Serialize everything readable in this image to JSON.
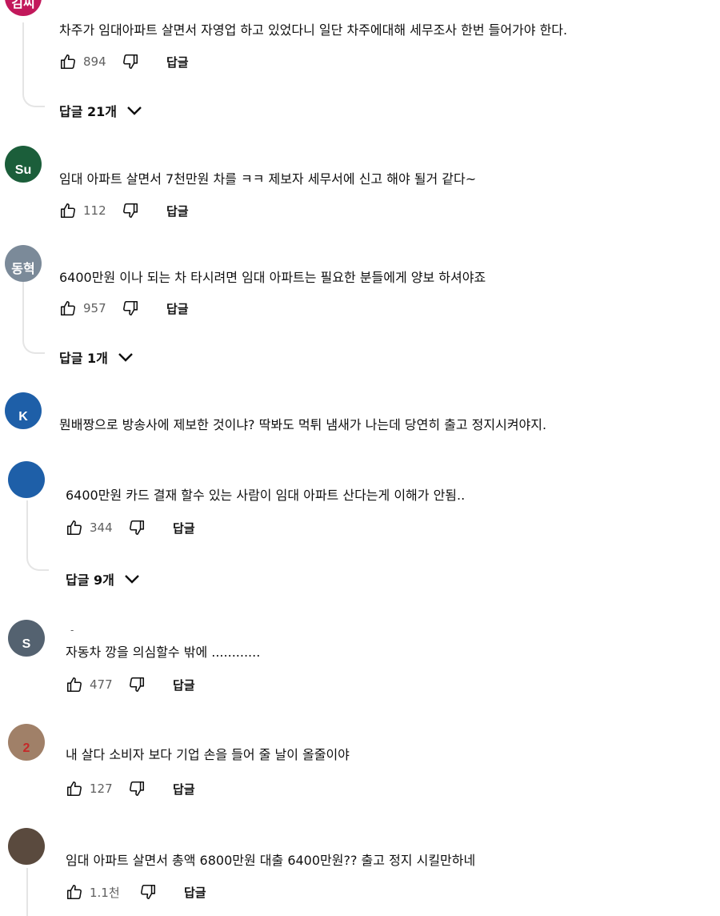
{
  "labels": {
    "reply": "답글"
  },
  "comments": [
    {
      "avatar_color": "#c2185b",
      "avatar_letter": "김씨",
      "text": "차주가 임대아파트 살면서 자영업 하고 있었다니 일단 차주에대해 세무조사 한번 들어가야 한다.",
      "likes": "894",
      "replies": "답글 21개"
    },
    {
      "avatar_color": "#1b5e3a",
      "avatar_letter": "Su",
      "text": "임대 아파트 살면서 7천만원 차를 ㅋㅋ  제보자 세무서에 신고 해야 될거 같다~",
      "likes": "112"
    },
    {
      "avatar_color": "#7b8a99",
      "avatar_letter": "동혁",
      "text": "6400만원 이나 되는 차 타시려면 임대 아파트는 필요한 분들에게 양보 하셔야죠",
      "likes": "957",
      "replies": "답글 1개"
    },
    {
      "avatar_color": "#1e5fa8",
      "avatar_letter": "K",
      "text": "뭔배짱으로 방송사에 제보한 것이냐? 딱봐도 먹튀 냄새가 나는데 당연히 출고 정지시켜야지."
    },
    {
      "avatar_color": "#1e5fa8",
      "avatar_letter": "",
      "text": "6400만원 카드 결재 할수 있는 사람이 임대 아파트 산다는게 이해가 안됨..",
      "likes": "344",
      "replies": "답글 9개"
    },
    {
      "avatar_color": "#546270",
      "avatar_letter": "S",
      "dash": "-",
      "text": "자동차 깡을 의심할수 밖에 ............",
      "likes": "477"
    },
    {
      "avatar_color": "#a08068",
      "avatar_letter": "2",
      "text": "내 살다 소비자 보다 기업 손을 들어 줄 날이 올줄이야",
      "likes": "127"
    },
    {
      "avatar_color": "#5a4a3e",
      "avatar_letter": "",
      "text": "임대 아파트 살면서 총액 6800만원 대출 6400만원?? 출고 정지 시킬만하네",
      "likes": "1.1천"
    }
  ]
}
